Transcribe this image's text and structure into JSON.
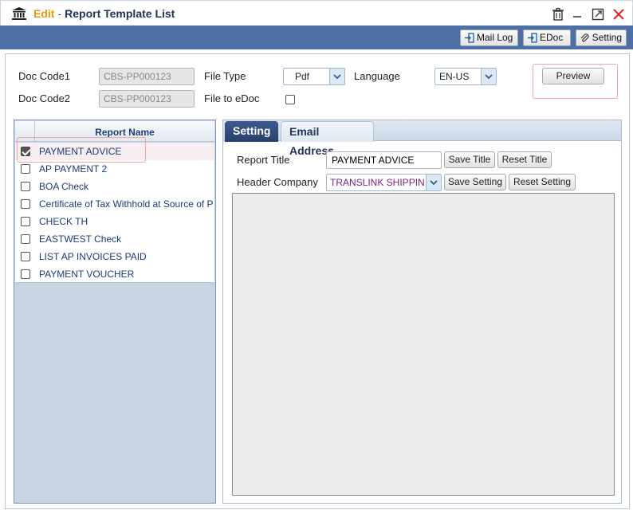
{
  "window": {
    "mode": "Edit",
    "separator": "-",
    "title": "Report Template List",
    "icons": [
      "bank-icon",
      "trash-icon",
      "minimize-icon",
      "maximize-icon",
      "close-icon"
    ]
  },
  "toolbar": {
    "mail_log": "Mail Log",
    "edoc": "EDoc",
    "setting": "Setting"
  },
  "form": {
    "doc_code1_label": "Doc Code1",
    "doc_code1_value": "CBS-PP000123",
    "doc_code2_label": "Doc Code2",
    "doc_code2_value": "CBS-PP000123",
    "file_type_label": "File Type",
    "file_type_value": "Pdf",
    "file_to_edoc_label": "File to eDoc",
    "file_to_edoc_checked": false,
    "language_label": "Language",
    "language_value": "EN-US",
    "preview_button": "Preview"
  },
  "report_list": {
    "header": "Report Name",
    "items": [
      {
        "name": "PAYMENT ADVICE",
        "checked": true
      },
      {
        "name": "AP PAYMENT 2",
        "checked": false
      },
      {
        "name": "BOA Check",
        "checked": false
      },
      {
        "name": "Certificate of Tax Withhold at Source of P",
        "checked": false
      },
      {
        "name": "CHECK TH",
        "checked": false
      },
      {
        "name": "EASTWEST Check",
        "checked": false
      },
      {
        "name": "LIST AP INVOICES PAID",
        "checked": false
      },
      {
        "name": "PAYMENT VOUCHER",
        "checked": false
      }
    ]
  },
  "tabs": {
    "setting": "Setting",
    "email_address": "Email Address"
  },
  "setting": {
    "report_title_label": "Report Title",
    "report_title_value": "PAYMENT ADVICE",
    "save_title": "Save Title",
    "reset_title": "Reset Title",
    "header_company_label": "Header Company",
    "header_company_value": "TRANSLINK SHIPPIN",
    "save_setting": "Save Setting",
    "reset_setting": "Reset Setting"
  },
  "colors": {
    "toolbar": "#4d6fa6",
    "edit_accent": "#f0960a",
    "highlight": "#f2a3a3",
    "company_text": "#7b1f7f"
  }
}
